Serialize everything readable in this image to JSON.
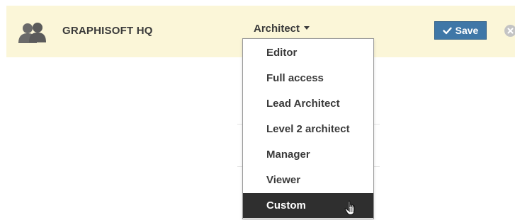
{
  "group": {
    "name": "GRAPHISOFT HQ",
    "icon": "group-icon"
  },
  "role_select": {
    "selected": "Architect",
    "icon": "caret-down-icon"
  },
  "save_button": {
    "label": "Save",
    "icon": "checkmark-icon",
    "color": "#3f77a7"
  },
  "remove_button": {
    "icon": "close-icon"
  },
  "dropdown": {
    "options": [
      "Editor",
      "Full access",
      "Lead Architect",
      "Level 2 architect",
      "Manager",
      "Viewer",
      "Custom"
    ],
    "highlighted_option": "Custom",
    "highlight_color": "#2f2f2f"
  },
  "row_background": "#fbf6d8",
  "cursor": {
    "icon": "hand-pointer-icon"
  }
}
